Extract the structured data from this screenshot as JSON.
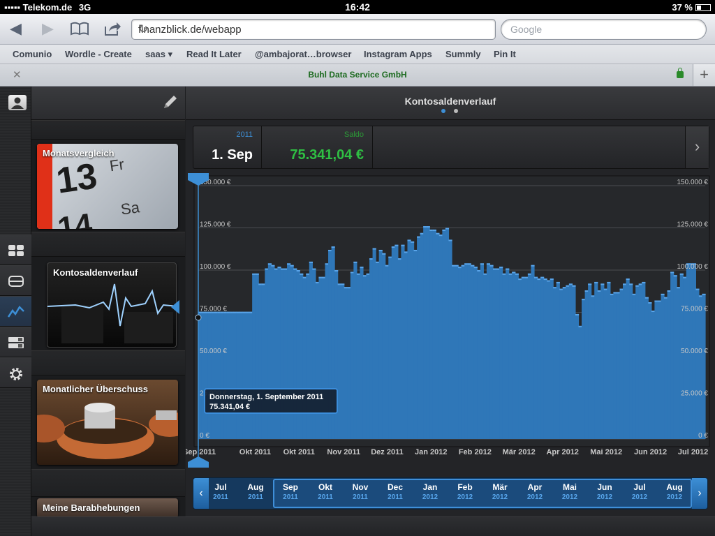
{
  "status_bar": {
    "carrier": "Telekom.de",
    "network": "3G",
    "time": "16:42",
    "battery": "37 %"
  },
  "browser": {
    "url": "finanzblick.de/webapp",
    "search_placeholder": "Google",
    "page_title": "Buhl Data Service GmbH",
    "bookmarks": [
      "Comunio",
      "Wordle - Create",
      "saas ▾",
      "Read It Later",
      "@ambajorat…browser",
      "Instagram Apps",
      "Summly",
      "Pin It"
    ]
  },
  "sidebar_cards": [
    {
      "label": "Monatsvergleich"
    },
    {
      "label": "Kontosaldenverlauf"
    },
    {
      "label": "Monatlicher Überschuss"
    },
    {
      "label": "Meine Barabhebungen"
    }
  ],
  "calendar_text": {
    "day1": "13",
    "dow1": "Fr",
    "day2": "14",
    "dow2": "Sa"
  },
  "main": {
    "title": "Kontosaldenverlauf",
    "info": {
      "year": "2011",
      "date": "1. Sep",
      "saldo_label": "Saldo",
      "saldo_value": "75.341,04 €"
    },
    "tooltip": {
      "line1": "Donnerstag, 1. September 2011",
      "line2": "75.341,04 €"
    }
  },
  "chart_data": {
    "type": "area",
    "title": "Kontosaldenverlauf",
    "ylim": [
      0,
      150000
    ],
    "yticks": [
      "0 €",
      "25.000 €",
      "50.000 €",
      "75.000 €",
      "100.000 €",
      "125.000 €",
      "150.000 €"
    ],
    "xlabels": [
      "Sep 2011",
      "Okt 2011",
      "Okt 2011",
      "Nov 2011",
      "Dez 2011",
      "Jan 2012",
      "Feb 2012",
      "Mär 2012",
      "Apr 2012",
      "Mai 2012",
      "Jun 2012",
      "Jul 2012"
    ],
    "series": [
      {
        "values": [
          75341,
          75341,
          75341,
          75341,
          75341,
          75341,
          75341,
          75341,
          75341,
          75341,
          75341,
          75341,
          75341,
          75341,
          75341,
          75341,
          75341,
          98000,
          98000,
          92000,
          92000,
          101000,
          104000,
          103000,
          101000,
          102000,
          101000,
          101000,
          104000,
          103000,
          101000,
          100000,
          98000,
          96000,
          98000,
          105000,
          101000,
          93000,
          96000,
          96000,
          104000,
          112000,
          114000,
          100000,
          92000,
          92000,
          90000,
          90000,
          99000,
          105000,
          98000,
          102000,
          97000,
          98000,
          107000,
          113000,
          105000,
          112000,
          110000,
          103000,
          108000,
          114000,
          115000,
          107000,
          115000,
          111000,
          118000,
          117000,
          112000,
          120000,
          122000,
          126000,
          126000,
          124000,
          124000,
          122000,
          121000,
          124000,
          125000,
          118000,
          103000,
          103000,
          102000,
          103000,
          104000,
          104000,
          103000,
          102000,
          100000,
          104000,
          98000,
          104000,
          103000,
          101000,
          101000,
          102000,
          98000,
          101000,
          98000,
          99000,
          98000,
          95000,
          96000,
          96000,
          98000,
          103000,
          96000,
          95000,
          96000,
          95000,
          94000,
          95000,
          90000,
          93000,
          89000,
          90000,
          91000,
          92000,
          91000,
          74000,
          67000,
          83000,
          88000,
          92000,
          85000,
          93000,
          88000,
          92000,
          89000,
          93000,
          86000,
          87000,
          87000,
          89000,
          92000,
          95000,
          92000,
          86000,
          91000,
          92000,
          93000,
          84000,
          81000,
          76000,
          82000,
          82000,
          86000,
          84000,
          88000,
          99000,
          97000,
          90000,
          98000,
          96000,
          104000,
          104000,
          104000,
          89000,
          85000,
          86000
        ]
      }
    ]
  },
  "timeline": {
    "months": [
      {
        "m": "Jul",
        "y": "2011"
      },
      {
        "m": "Aug",
        "y": "2011"
      },
      {
        "m": "Sep",
        "y": "2011"
      },
      {
        "m": "Okt",
        "y": "2011"
      },
      {
        "m": "Nov",
        "y": "2011"
      },
      {
        "m": "Dec",
        "y": "2011"
      },
      {
        "m": "Jan",
        "y": "2012"
      },
      {
        "m": "Feb",
        "y": "2012"
      },
      {
        "m": "Mär",
        "y": "2012"
      },
      {
        "m": "Apr",
        "y": "2012"
      },
      {
        "m": "Mai",
        "y": "2012"
      },
      {
        "m": "Jun",
        "y": "2012"
      },
      {
        "m": "Jul",
        "y": "2012"
      },
      {
        "m": "Aug",
        "y": "2012"
      }
    ]
  }
}
